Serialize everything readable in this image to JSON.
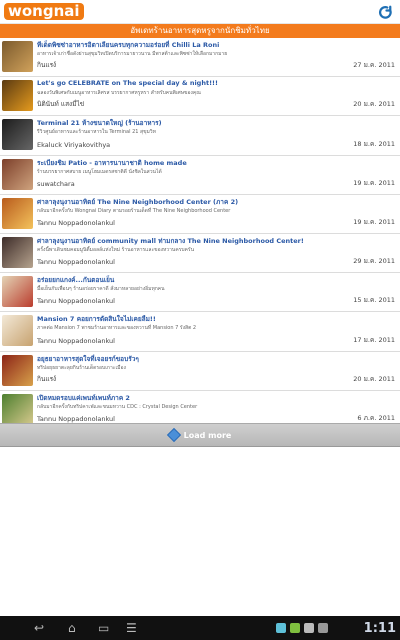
{
  "app": {
    "logo_text": "wongnai"
  },
  "banner": {
    "text": "อัพเดทร้านอาหารสุดหรูจากนักชิมทั่วไทย"
  },
  "feed": [
    {
      "title": "ทีเด็ดพิซซ่าอาหารอิตาเลียนครบทุกความอร่อยที่ Chilli La Roni",
      "desc": "อาหารเจ้าเก่าชื่อดังย่านสุขุมวิทเปิดบริการมายาวนาน มีพาสต้าและพิซซ่าให้เลือกมากมาย",
      "author": "กินแรง์",
      "date": "27 ม.ค. 2011",
      "color1": "#7b5a2d",
      "color2": "#d1a25b"
    },
    {
      "title": "Let's go CELEBRATE on The special day & night!!!",
      "desc": "ฉลองวันพิเศษกับเมนูอาหารเลิศรส บรรยากาศหรูหรา สำหรับคนพิเศษของคุณ",
      "author": "นิตินันท์ แสงมี่ไข่",
      "date": "20 ม.ค. 2011",
      "color1": "#5a3a12",
      "color2": "#e59b1e"
    },
    {
      "title": "Terminal 21 ห้างขนาดใหญ่ (ร้านอาหาร)",
      "desc": "รีวิวศูนย์อาหารและร้านอาหารใน Terminal 21 สุขุมวิท",
      "author": "Ekaluck Viriyakovithya",
      "date": "18 ม.ค. 2011",
      "color1": "#1c1c1c",
      "color2": "#666666"
    },
    {
      "title": "ระเบียงชิม Patio - อาหารนานาชาติ home made",
      "desc": "ร้านบรรยากาศสบาย เมนูโฮมเมดรสชาติดี นั่งชิลในสวนได้",
      "author": "suwatchara",
      "date": "19 ม.ค. 2011",
      "color1": "#7c3f2a",
      "color2": "#cfa37e"
    },
    {
      "title": "ศาลาลุงนุงานอาทิตย์ The Nine Neighborhood Center (ภาค 2)",
      "desc": "กลับมาอีกครั้งกับ Wongnai Diary ตามรอยร้านเด็ดที่ The Nine Neighborhood Center",
      "author": "Tannu Noppadonolankul",
      "date": "19 ม.ค. 2011",
      "color1": "#b85b1d",
      "color2": "#f4c35c"
    },
    {
      "title": "ศาลาลุงนุงานอาทิตย์ community mall ท่ามกลาง The Nine Neighborhood Center!",
      "desc": "ครั้งนี้พาเดินชมคอมมูนิตี้มอลล์แห่งใหม่ ร้านอาหารและของหวานครบครัน",
      "author": "Tannu Noppadonolankul",
      "date": "29 ม.ค. 2011",
      "color1": "#3d2c29",
      "color2": "#b6a38e"
    },
    {
      "title": "อร่อยยกแกงค์...กันตอนเย็น",
      "desc": "มื้อเย็นกับเพื่อนๆ ร้านอร่อยราคาดี สั่งมาหลายอย่างอิ่มทุกคน",
      "author": "Tannu Noppadonolankul",
      "date": "15 ม.ค. 2011",
      "color1": "#e4d4b6",
      "color2": "#ba3c2d"
    },
    {
      "title": "Mansion 7 คอยการตัดสินใจไม่เคยลืม!!",
      "desc": "ภาคต่อ Mansion 7 พาชมร้านอาหารและของหวานที่ Mansion 7 รังสิต 2",
      "author": "Tannu Noppadonolankul",
      "date": "17 ม.ค. 2011",
      "color1": "#f3e9d8",
      "color2": "#c7a26f"
    },
    {
      "title": "อยุธยาอาหารสุดใจที่เจอยรก์ขอบรัวๆ",
      "desc": "ทริปอยุธยาตะลุยกินร้านเด็ดรอบเกาะเมือง",
      "author": "กินแรง์",
      "date": "20 ม.ค. 2011",
      "color1": "#8c2417",
      "color2": "#d8a14b"
    },
    {
      "title": "เปิดหมดรอบแค่เพนท์เพนท์ภาค 2",
      "desc": "กลับมาอีกครั้งกับทริปคาเฟ่และขนมหวาน CDC : Crystal Design Center",
      "author": "Tannu Noppadonolankul",
      "date": "6 ภ.ค. 2011",
      "color1": "#4d7f2f",
      "color2": "#d6c98d"
    }
  ],
  "load_more": {
    "label": "Load more"
  },
  "status": {
    "time": "1:11"
  },
  "icon_names": {
    "refresh": "refresh-icon",
    "back": "back-arrow-icon",
    "home": "home-icon",
    "recent": "recent-apps-icon",
    "menu": "menu-icon",
    "diamond": "load-more-diamond-icon"
  }
}
